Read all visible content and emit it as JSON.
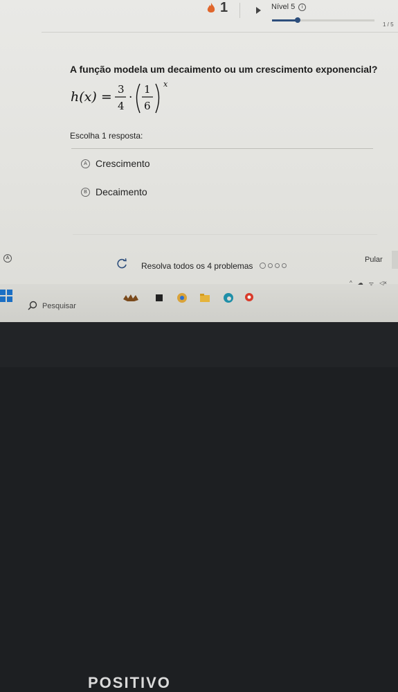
{
  "header": {
    "streak": "1",
    "level_label": "Nível 5",
    "info_icon": "ⓘ",
    "progress_fraction": 0.25,
    "progress_count": "1 / 5"
  },
  "question": {
    "prompt": "A função modela um decaimento ou um crescimento exponencial?",
    "formula": {
      "lhs": "h(x) =",
      "coef_num": "3",
      "coef_den": "4",
      "dot": "·",
      "base_num": "1",
      "base_den": "6",
      "exponent": "x"
    },
    "instruction": "Escolha 1 resposta:"
  },
  "options": [
    {
      "letter": "A",
      "label": "Crescimento"
    },
    {
      "letter": "B",
      "label": "Decaimento"
    }
  ],
  "footer": {
    "left_badge": "A",
    "solve_label": "Resolva todos os 4 problemas",
    "skip_label": "Pular"
  },
  "taskbar": {
    "search_placeholder": "Pesquisar",
    "icons": [
      "windows-icon",
      "search-icon",
      "animal-icon",
      "app-icon",
      "chrome-icon",
      "folder-icon",
      "edge-icon",
      "maps-icon"
    ],
    "tray": [
      "^",
      "☁",
      "ᯤ",
      "◁×"
    ]
  },
  "device": {
    "brand": "POSITIVO"
  },
  "colors": {
    "accent": "#2d4e7c",
    "windows_blue": "#1b6fc4",
    "flame": "#e0662c"
  }
}
